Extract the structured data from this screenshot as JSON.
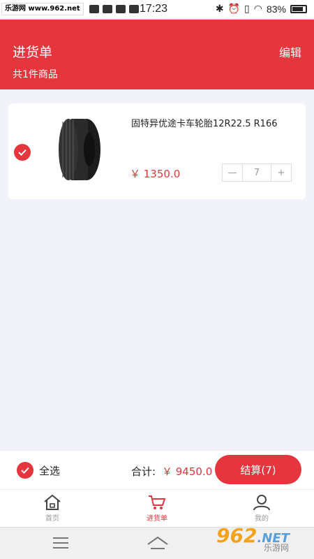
{
  "status_bar": {
    "watermark": "乐游网 www.962.net",
    "time": "17:23",
    "battery": "83%"
  },
  "header": {
    "title": "进货单",
    "edit_label": "编辑",
    "count_text": "共1件商品"
  },
  "cart": {
    "items": [
      {
        "name": "固特异优途卡车轮胎12R22.5 R166",
        "price": "￥ 1350.0",
        "quantity": "7",
        "checked": true,
        "image_icon": "tire-icon"
      }
    ]
  },
  "bottom_bar": {
    "select_all_label": "全选",
    "total_label": "合计:",
    "total_value": "￥ 9450.0",
    "checkout_label": "结算(7)"
  },
  "tabs": [
    {
      "label": "首页",
      "icon": "home-icon",
      "active": false
    },
    {
      "label": "进货单",
      "icon": "cart-icon",
      "active": true
    },
    {
      "label": "我的",
      "icon": "user-icon",
      "active": false
    }
  ],
  "watermark_logo": {
    "number": "962",
    "suffix": ".NET",
    "text": "乐游网"
  },
  "colors": {
    "accent": "#e5353d",
    "background": "#f2f3f8"
  }
}
